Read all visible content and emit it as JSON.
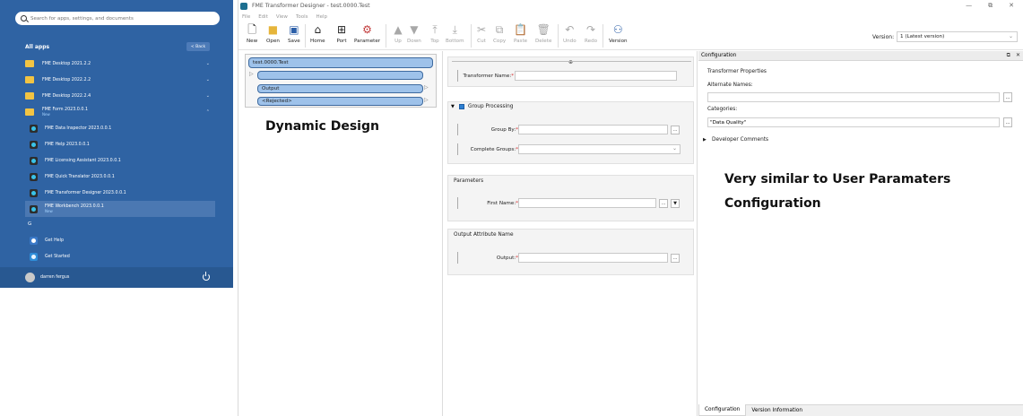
{
  "start_menu": {
    "search_placeholder": "Search for apps, settings, and documents",
    "all_apps_label": "All apps",
    "back_label": "< Back",
    "folders": [
      {
        "label": "FME Desktop 2021.2.2",
        "chevron": "⌄"
      },
      {
        "label": "FME Desktop 2022.2.2",
        "chevron": "⌄"
      },
      {
        "label": "FME Desktop 2022.2.4",
        "chevron": "⌄"
      },
      {
        "label": "FME Form 2023.0.0.1",
        "badge": "New",
        "chevron": "⌃"
      }
    ],
    "apps": [
      {
        "label": "FME Data Inspector 2023.0.0.1"
      },
      {
        "label": "FME Help 2023.0.0.1"
      },
      {
        "label": "FME Licensing Assistant 2023.0.0.1"
      },
      {
        "label": "FME Quick Translator 2023.0.0.1"
      },
      {
        "label": "FME Transformer Designer 2023.0.0.1"
      },
      {
        "label": "FME Workbench 2023.0.0.1",
        "badge": "New"
      }
    ],
    "letter_g": "G",
    "g_apps": [
      {
        "label": "Get Help"
      },
      {
        "label": "Get Started"
      }
    ],
    "user_name": "darren fergus"
  },
  "designer": {
    "title": "FME Transformer Designer - test.0000.Test",
    "window_controls": [
      "—",
      "⧉",
      "✕"
    ],
    "menu": [
      "File",
      "Edit",
      "View",
      "Tools",
      "Help"
    ],
    "toolbar": {
      "new": "New",
      "open": "Open",
      "save": "Save",
      "home": "Home",
      "port": "Port",
      "parameter": "Parameter",
      "up": "Up",
      "down": "Down",
      "top": "Top",
      "bottom": "Bottom",
      "cut": "Cut",
      "copy": "Copy",
      "paste": "Paste",
      "delete": "Delete",
      "undo": "Undo",
      "redo": "Redo",
      "version": "Version"
    },
    "version_label": "Version:",
    "version_value": "1 (Latest version)",
    "canvas": {
      "transformer_name": "test.0000.Test",
      "output_port": "Output",
      "rejected_port": "<Rejected>",
      "overlay_text": "Dynamic Design"
    },
    "parameters": {
      "transformer_name_label": "Transformer Name:",
      "group_processing_label": "Group Processing",
      "group_by_label": "Group By:",
      "complete_groups_label": "Complete Groups:",
      "parameters_section": "Parameters",
      "first_name_label": "First Name:",
      "output_attr_section": "Output Attribute Name",
      "output_label": "Output:",
      "required_mark": "*",
      "ellipsis": "..."
    },
    "configuration": {
      "header": "Configuration",
      "transformer_properties": "Transformer Properties",
      "alternate_names_label": "Alternate Names:",
      "categories_label": "Categories:",
      "categories_value": "\"Data Quality\"",
      "developer_comments": "Developer Comments",
      "overlay_line1": "Very similar to User Paramaters",
      "overlay_line2": "Configuration",
      "tabs": [
        "Configuration",
        "Version Information"
      ]
    }
  }
}
